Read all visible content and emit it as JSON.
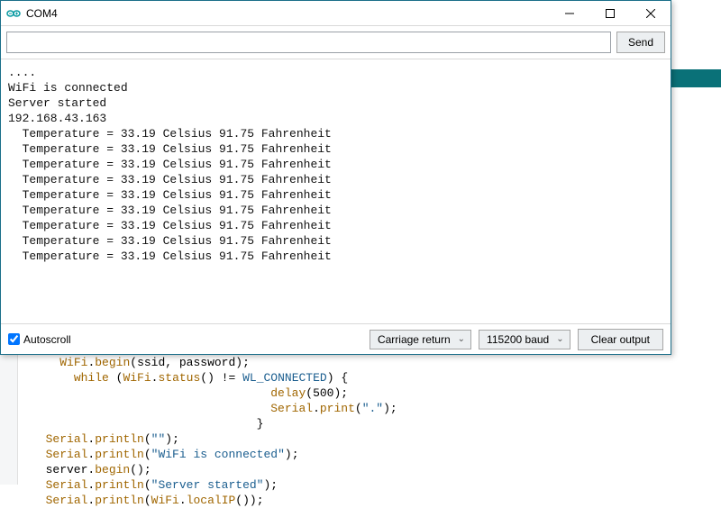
{
  "window": {
    "title": "COM4"
  },
  "send": {
    "placeholder": "",
    "button_label": "Send"
  },
  "output_lines": [
    "....",
    "WiFi is connected",
    "Server started",
    "192.168.43.163",
    "  Temperature = 33.19 Celsius 91.75 Fahrenheit",
    "  Temperature = 33.19 Celsius 91.75 Fahrenheit",
    "  Temperature = 33.19 Celsius 91.75 Fahrenheit",
    "  Temperature = 33.19 Celsius 91.75 Fahrenheit",
    "  Temperature = 33.19 Celsius 91.75 Fahrenheit",
    "  Temperature = 33.19 Celsius 91.75 Fahrenheit",
    "  Temperature = 33.19 Celsius 91.75 Fahrenheit",
    "  Temperature = 33.19 Celsius 91.75 Fahrenheit",
    "  Temperature = 33.19 Celsius 91.75 Fahrenheit"
  ],
  "bottom": {
    "autoscroll_label": "Autoscroll",
    "autoscroll_checked": true,
    "line_ending": "Carriage return",
    "baud": "115200 baud",
    "clear_label": "Clear output"
  },
  "code": {
    "lines": [
      {
        "indent": 2,
        "tokens": [
          {
            "t": "WiFi",
            "c": "fn"
          },
          {
            "t": "."
          },
          {
            "t": "begin",
            "c": "fn"
          },
          {
            "t": "(ssid, password);"
          }
        ]
      },
      {
        "indent": 3,
        "tokens": [
          {
            "t": "while",
            "c": "kw"
          },
          {
            "t": " ("
          },
          {
            "t": "WiFi",
            "c": "fn"
          },
          {
            "t": "."
          },
          {
            "t": "status",
            "c": "fn"
          },
          {
            "t": "() != "
          },
          {
            "t": "WL_CONNECTED",
            "c": "con"
          },
          {
            "t": ") {"
          }
        ]
      },
      {
        "indent": 17,
        "tokens": [
          {
            "t": "delay",
            "c": "fn"
          },
          {
            "t": "(500);"
          }
        ]
      },
      {
        "indent": 17,
        "tokens": [
          {
            "t": "Serial",
            "c": "fn"
          },
          {
            "t": "."
          },
          {
            "t": "print",
            "c": "fn"
          },
          {
            "t": "("
          },
          {
            "t": "\".\"",
            "c": "str"
          },
          {
            "t": ");"
          }
        ]
      },
      {
        "indent": 16,
        "tokens": [
          {
            "t": "}"
          }
        ]
      },
      {
        "indent": 1,
        "tokens": [
          {
            "t": "Serial",
            "c": "fn"
          },
          {
            "t": "."
          },
          {
            "t": "println",
            "c": "fn"
          },
          {
            "t": "("
          },
          {
            "t": "\"\"",
            "c": "str"
          },
          {
            "t": ");"
          }
        ]
      },
      {
        "indent": 1,
        "tokens": [
          {
            "t": "Serial",
            "c": "fn"
          },
          {
            "t": "."
          },
          {
            "t": "println",
            "c": "fn"
          },
          {
            "t": "("
          },
          {
            "t": "\"WiFi is connected\"",
            "c": "str"
          },
          {
            "t": ");"
          }
        ]
      },
      {
        "indent": 1,
        "tokens": [
          {
            "t": "server."
          },
          {
            "t": "begin",
            "c": "fn"
          },
          {
            "t": "();"
          }
        ]
      },
      {
        "indent": 1,
        "tokens": [
          {
            "t": "Serial",
            "c": "fn"
          },
          {
            "t": "."
          },
          {
            "t": "println",
            "c": "fn"
          },
          {
            "t": "("
          },
          {
            "t": "\"Server started\"",
            "c": "str"
          },
          {
            "t": ");"
          }
        ]
      },
      {
        "indent": 1,
        "tokens": [
          {
            "t": "Serial",
            "c": "fn"
          },
          {
            "t": "."
          },
          {
            "t": "println",
            "c": "fn"
          },
          {
            "t": "("
          },
          {
            "t": "WiFi",
            "c": "fn"
          },
          {
            "t": "."
          },
          {
            "t": "localIP",
            "c": "fn"
          },
          {
            "t": "());"
          }
        ]
      }
    ]
  }
}
